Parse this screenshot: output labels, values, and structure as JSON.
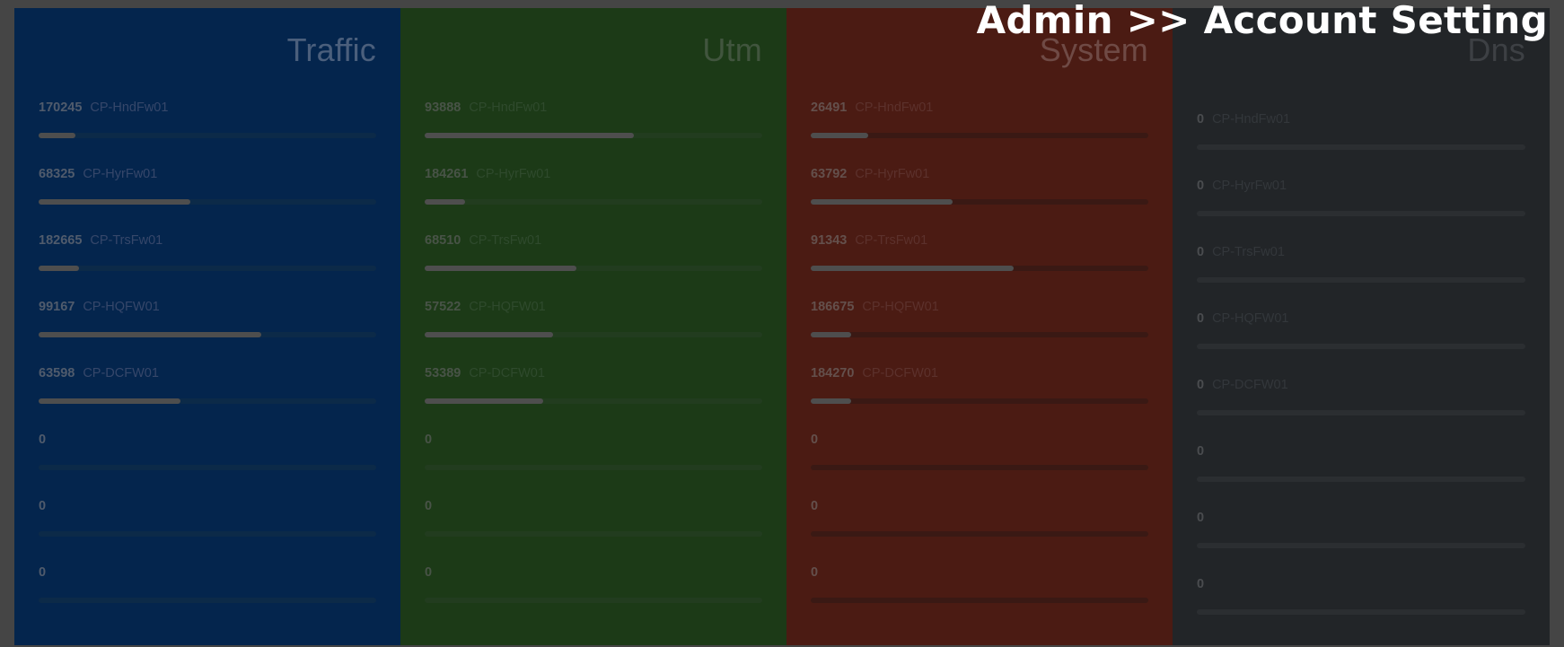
{
  "breadcrumb": "Admin >> Account Setting",
  "colors": {
    "backdrop": "#454545",
    "traffic": "#04254d",
    "utm": "#1c3a17",
    "system": "#4b1b13",
    "dns": "#222528"
  },
  "panels": [
    {
      "title": "Traffic",
      "rows": [
        {
          "value": "170245",
          "host": "CP-HndFw01",
          "level": 0.11
        },
        {
          "value": "68325",
          "host": "CP-HyrFw01",
          "level": 0.45
        },
        {
          "value": "182665",
          "host": "CP-TrsFw01",
          "level": 0.12
        },
        {
          "value": "99167",
          "host": "CP-HQFW01",
          "level": 0.66
        },
        {
          "value": "63598",
          "host": "CP-DCFW01",
          "level": 0.42
        },
        {
          "value": "0",
          "host": "",
          "level": 0
        },
        {
          "value": "0",
          "host": "",
          "level": 0
        },
        {
          "value": "0",
          "host": "",
          "level": 0
        }
      ]
    },
    {
      "title": "Utm",
      "rows": [
        {
          "value": "93888",
          "host": "CP-HndFw01",
          "level": 0.62
        },
        {
          "value": "184261",
          "host": "CP-HyrFw01",
          "level": 0.12
        },
        {
          "value": "68510",
          "host": "CP-TrsFw01",
          "level": 0.45
        },
        {
          "value": "57522",
          "host": "CP-HQFW01",
          "level": 0.38
        },
        {
          "value": "53389",
          "host": "CP-DCFW01",
          "level": 0.35
        },
        {
          "value": "0",
          "host": "",
          "level": 0
        },
        {
          "value": "0",
          "host": "",
          "level": 0
        },
        {
          "value": "0",
          "host": "",
          "level": 0
        }
      ]
    },
    {
      "title": "System",
      "rows": [
        {
          "value": "26491",
          "host": "CP-HndFw01",
          "level": 0.17
        },
        {
          "value": "63792",
          "host": "CP-HyrFw01",
          "level": 0.42
        },
        {
          "value": "91343",
          "host": "CP-TrsFw01",
          "level": 0.6
        },
        {
          "value": "186675",
          "host": "CP-HQFW01",
          "level": 0.12
        },
        {
          "value": "184270",
          "host": "CP-DCFW01",
          "level": 0.12
        },
        {
          "value": "0",
          "host": "",
          "level": 0
        },
        {
          "value": "0",
          "host": "",
          "level": 0
        },
        {
          "value": "0",
          "host": "",
          "level": 0
        }
      ]
    },
    {
      "title": "Dns",
      "rows": [
        {
          "value": "0",
          "host": "CP-HndFw01",
          "level": 0
        },
        {
          "value": "0",
          "host": "CP-HyrFw01",
          "level": 0
        },
        {
          "value": "0",
          "host": "CP-TrsFw01",
          "level": 0
        },
        {
          "value": "0",
          "host": "CP-HQFW01",
          "level": 0
        },
        {
          "value": "0",
          "host": "CP-DCFW01",
          "level": 0
        },
        {
          "value": "0",
          "host": "",
          "level": 0
        },
        {
          "value": "0",
          "host": "",
          "level": 0
        },
        {
          "value": "0",
          "host": "",
          "level": 0
        }
      ]
    }
  ]
}
